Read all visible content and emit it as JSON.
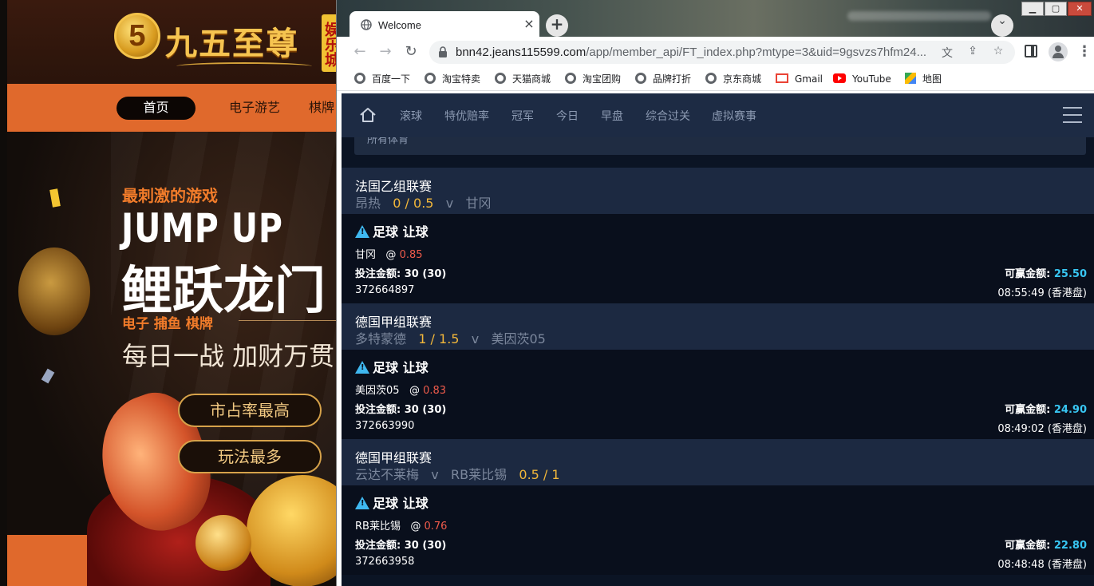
{
  "background_site": {
    "logo": {
      "digit": "5",
      "name": "九五至尊",
      "badge": "娱乐城"
    },
    "nav": [
      "首页",
      "电子游艺",
      "棋牌"
    ],
    "banner": {
      "tagline": "最刺激的游戏",
      "headline_en": "JUMP UP",
      "headline_cn": "鲤跃龙门",
      "categories": "电子  捕鱼  棋牌",
      "slogan": "每日一战  加财万贯",
      "pill1": "市占率最高",
      "pill2": "玩法最多"
    }
  },
  "browser": {
    "tab_title": "Welcome",
    "tab_close": "×",
    "new_tab": "+",
    "url_host": "bnn42.jeans115599.com",
    "url_path": "/app/member_api/FT_index.php?mtype=3&uid=9gsvzs7hfm24...",
    "bookmarks": [
      "百度一下",
      "淘宝特卖",
      "天猫商城",
      "淘宝团购",
      "品牌打折",
      "京东商城",
      "Gmail",
      "YouTube",
      "地图"
    ],
    "window_controls": {
      "min": "▁",
      "max": "▢",
      "close": "✕"
    }
  },
  "site": {
    "nav": [
      "滚球",
      "特优赔率",
      "冠军",
      "今日",
      "早盘",
      "综合过关",
      "虚拟赛事"
    ],
    "sport_filter": "所有体育",
    "bets": [
      {
        "league": "法国乙组联赛",
        "home": "昂热",
        "handicap": "0 / 0.5",
        "vs": "v",
        "away": "甘冈",
        "type": "足球 让球",
        "pick": "甘冈",
        "at": "@",
        "odds": "0.85",
        "stake_label": "投注金额:",
        "stake": "30 (30)",
        "win_label": "可赢金额:",
        "win": "25.50",
        "ticket": "372664897",
        "time": "08:55:49 (香港盘)"
      },
      {
        "league": "德国甲组联赛",
        "home": "多特蒙德",
        "handicap": "1 / 1.5",
        "vs": "v",
        "away": "美因茨05",
        "type": "足球 让球",
        "pick": "美因茨05",
        "at": "@",
        "odds": "0.83",
        "stake_label": "投注金额:",
        "stake": "30 (30)",
        "win_label": "可赢金额:",
        "win": "24.90",
        "ticket": "372663990",
        "time": "08:49:02 (香港盘)"
      },
      {
        "league": "德国甲组联赛",
        "home": "云达不莱梅",
        "vs": "v",
        "away": "RB莱比锡",
        "handicap": "0.5 / 1",
        "type": "足球 让球",
        "pick": "RB莱比锡",
        "at": "@",
        "odds": "0.76",
        "stake_label": "投注金额:",
        "stake": "30 (30)",
        "win_label": "可赢金额:",
        "win": "22.80",
        "ticket": "372663958",
        "time": "08:48:48 (香港盘)"
      }
    ]
  },
  "colors": {
    "accent_odds": "#ef5b4b",
    "accent_win": "#38c6f2",
    "handicap": "#f2b73a",
    "nav_bg": "#1d2b44"
  }
}
